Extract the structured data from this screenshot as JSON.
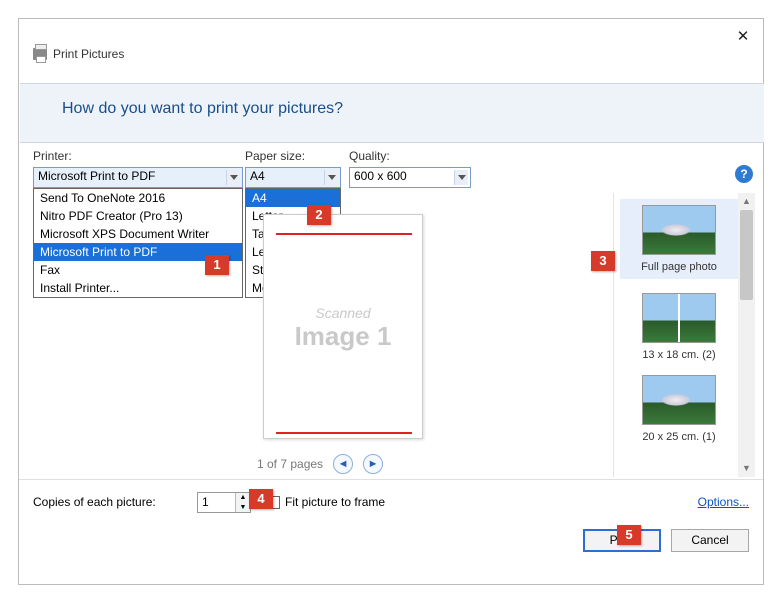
{
  "window": {
    "title": "Print Pictures",
    "prompt": "How do you want to print your pictures?"
  },
  "labels": {
    "printer": "Printer:",
    "paper": "Paper size:",
    "quality": "Quality:",
    "copies": "Copies of each picture:",
    "fit": "Fit picture to frame",
    "options": "Options..."
  },
  "printer": {
    "selected": "Microsoft Print to PDF",
    "options": [
      "Send To OneNote 2016",
      "Nitro PDF Creator (Pro 13)",
      "Microsoft XPS Document Writer",
      "Microsoft Print to PDF",
      "Fax",
      "Install Printer..."
    ],
    "highlight_index": 3
  },
  "paper": {
    "selected": "A4",
    "options": [
      "A4",
      "Letter",
      "Tabloid",
      "Legal",
      "Statement",
      "More..."
    ],
    "highlight_index": 0
  },
  "quality": {
    "selected": "600 x 600"
  },
  "preview": {
    "line1": "Scanned",
    "line2": "Image 1",
    "pager": "1 of 7 pages"
  },
  "layouts": [
    {
      "label": "Full page photo",
      "type": "single",
      "selected": true
    },
    {
      "label": "13 x 18 cm. (2)",
      "type": "double",
      "selected": false
    },
    {
      "label": "20 x 25 cm. (1)",
      "type": "single",
      "selected": false
    }
  ],
  "copies": {
    "value": "1"
  },
  "buttons": {
    "print": "Print",
    "cancel": "Cancel"
  },
  "callouts": {
    "c1": "1",
    "c2": "2",
    "c3": "3",
    "c4": "4",
    "c5": "5"
  }
}
